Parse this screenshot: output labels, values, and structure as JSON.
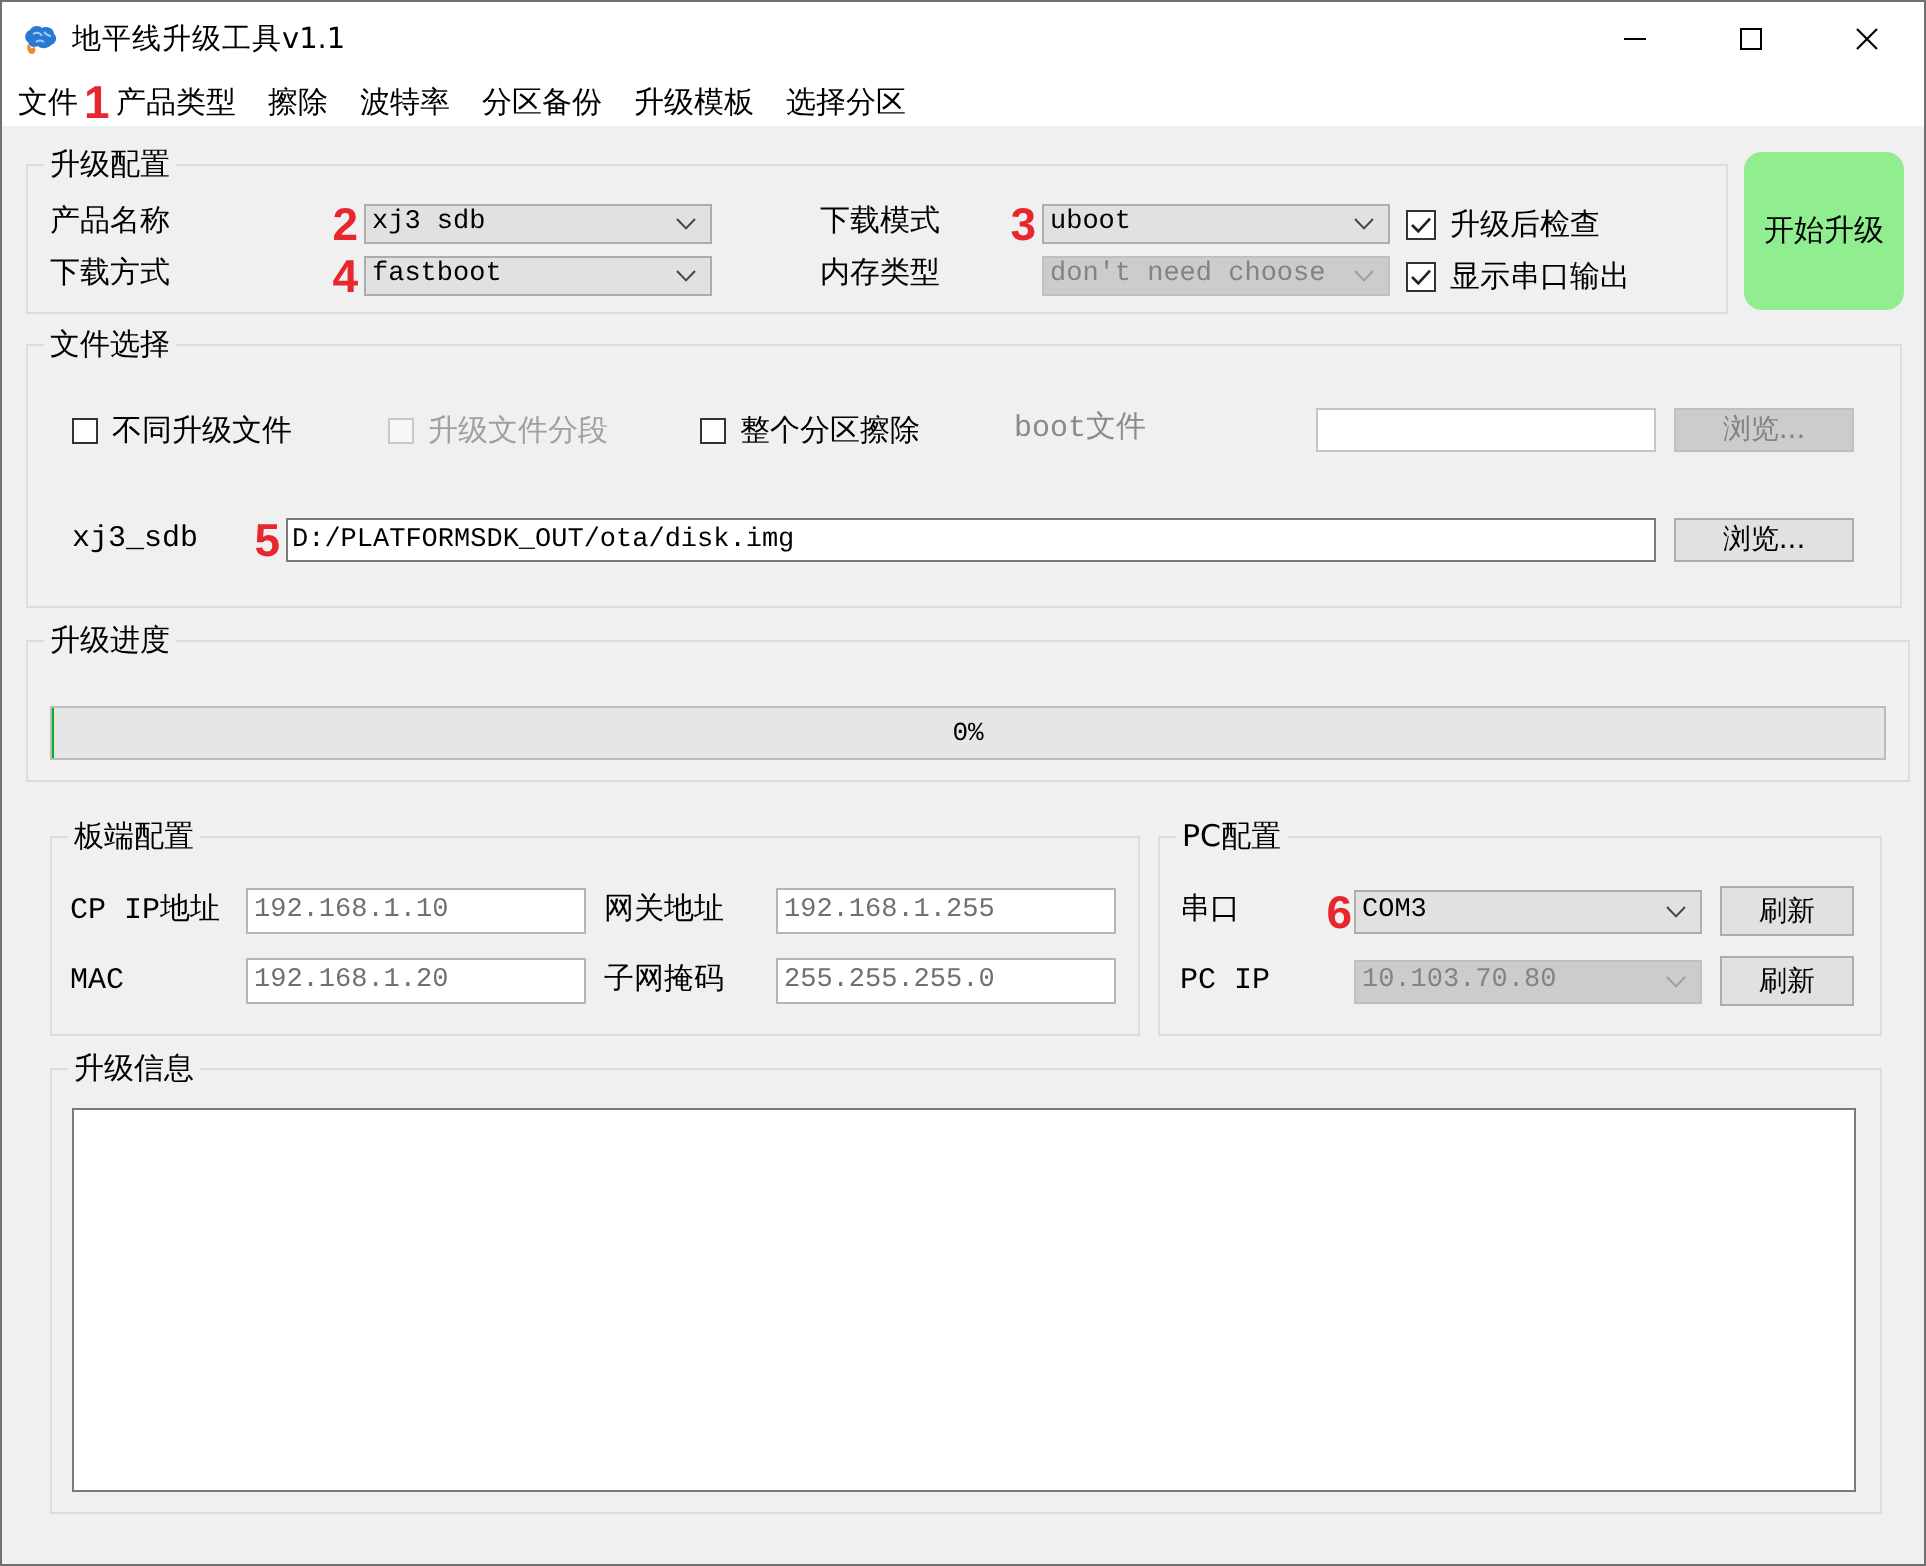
{
  "window": {
    "title": "地平线升级工具v1.1"
  },
  "menu": [
    {
      "label": "文件"
    },
    {
      "label": "产品类型",
      "callout": "1"
    },
    {
      "label": "擦除"
    },
    {
      "label": "波特率"
    },
    {
      "label": "分区备份"
    },
    {
      "label": "升级模板"
    },
    {
      "label": "选择分区"
    }
  ],
  "upgrade_config": {
    "title": "升级配置",
    "rows": [
      {
        "fields": [
          {
            "label": "产品名称",
            "callout": "2",
            "value": "xj3 sdb",
            "disabled": false
          },
          {
            "label": "下载模式",
            "callout": "3",
            "value": "uboot",
            "disabled": false
          }
        ],
        "checkbox": {
          "label": "升级后检查",
          "checked": true
        }
      },
      {
        "fields": [
          {
            "label": "下载方式",
            "callout": "4",
            "value": "fastboot",
            "disabled": false
          },
          {
            "label": "内存类型",
            "value": "don't need choose",
            "disabled": true
          }
        ],
        "checkbox": {
          "label": "显示串口输出",
          "checked": true
        }
      }
    ]
  },
  "start_button": {
    "label": "开始升级"
  },
  "file_select": {
    "title": "文件选择",
    "options": [
      {
        "label": "不同升级文件",
        "checked": false,
        "disabled": false
      },
      {
        "label": "升级文件分段",
        "checked": false,
        "disabled": true
      },
      {
        "label": "整个分区擦除",
        "checked": false,
        "disabled": false
      }
    ],
    "files": [
      {
        "label": "boot文件",
        "disabled": true,
        "button": "浏览..."
      },
      {
        "label": "xj3_sdb",
        "callout": "5",
        "value": "D:/PLATFORMSDK_OUT/ota/disk.img",
        "disabled": false,
        "button": "浏览..."
      }
    ]
  },
  "progress": {
    "title": "升级进度",
    "level": 0,
    "reading": "0%"
  },
  "board_config": {
    "title": "板端配置",
    "fields": [
      {
        "label": "CP IP地址",
        "placeholder": "192.168.1.10"
      },
      {
        "label": "网关地址",
        "placeholder": "192.168.1.255"
      },
      {
        "label": "MAC",
        "placeholder": "192.168.1.20"
      },
      {
        "label": "子网掩码",
        "placeholder": "255.255.255.0"
      }
    ]
  },
  "pc_config": {
    "title": "PC配置",
    "rows": [
      {
        "label": "串口",
        "callout": "6",
        "value": "COM3",
        "disabled": false,
        "button": "刷新"
      },
      {
        "label": "PC IP",
        "value": "10.103.70.80",
        "disabled": true,
        "button": "刷新"
      }
    ]
  },
  "log": {
    "title": "升级信息"
  }
}
